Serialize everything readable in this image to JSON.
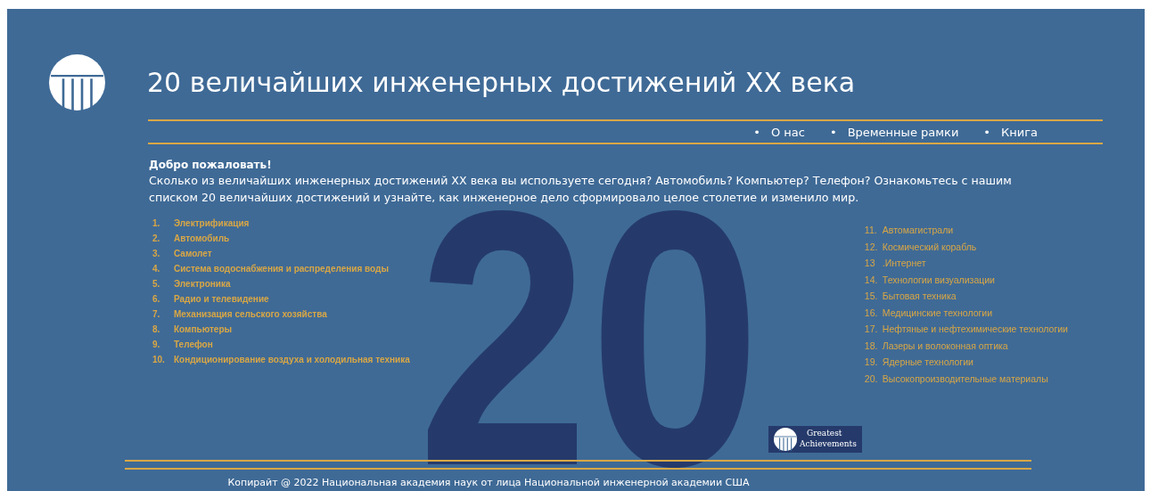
{
  "header": {
    "title": "20 величайших инженерных достижений XX века"
  },
  "nav": [
    {
      "bullet": "•",
      "label": "О нас"
    },
    {
      "bullet": "•",
      "label": "Временные рамки"
    },
    {
      "bullet": "•",
      "label": "Книга"
    }
  ],
  "welcome": {
    "heading": "Добро пожаловать!",
    "text": "Сколько из величайших инженерных достижений XX века вы используете сегодня? Автомобиль? Компьютер? Телефон? Ознакомьтесь с нашим списком 20 величайших достижений и узнайте, как инженерное дело сформировало целое столетие и изменило мир."
  },
  "big_number": "20",
  "list_left": [
    {
      "number": "1.",
      "label": "Электрификация"
    },
    {
      "number": "2.",
      "label": "Автомобиль"
    },
    {
      "number": "3.",
      "label": "Самолет"
    },
    {
      "number": "4.",
      "label": "Система водоснабжения и распределения воды"
    },
    {
      "number": "5.",
      "label": "Электроника"
    },
    {
      "number": "6.",
      "label": "Радио и телевидение"
    },
    {
      "number": "7.",
      "label": "Механизация сельского хозяйства"
    },
    {
      "number": "8.",
      "label": "Компьютеры"
    },
    {
      "number": "9.",
      "label": "Телефон"
    },
    {
      "number": "10.",
      "label": "Кондиционирование воздуха и холодильная техника"
    }
  ],
  "list_right": [
    {
      "number": "11.",
      "label": "Автомагистрали"
    },
    {
      "number": "12.",
      "label": "Космический корабль"
    },
    {
      "number": "13",
      "label": ".Интернет"
    },
    {
      "number": "14.",
      "label": "Технологии визуализации"
    },
    {
      "number": "15.",
      "label": "Бытовая техника"
    },
    {
      "number": "16.",
      "label": "Медицинские технологии"
    },
    {
      "number": "17.",
      "label": "Нефтяные и нефтехимические технологии"
    },
    {
      "number": "18.",
      "label": "Лазеры и волоконная оптика"
    },
    {
      "number": "19.",
      "label": "Ядерные технологии"
    },
    {
      "number": "20.",
      "label": "Высокопроизводительные материалы"
    }
  ],
  "footer": {
    "logo_line_1": "Greatest",
    "logo_line_2": "Achievements",
    "copyright": "Копирайт @ 2022 Национальная  академия наук от лица Национальной инженерной академии США"
  }
}
